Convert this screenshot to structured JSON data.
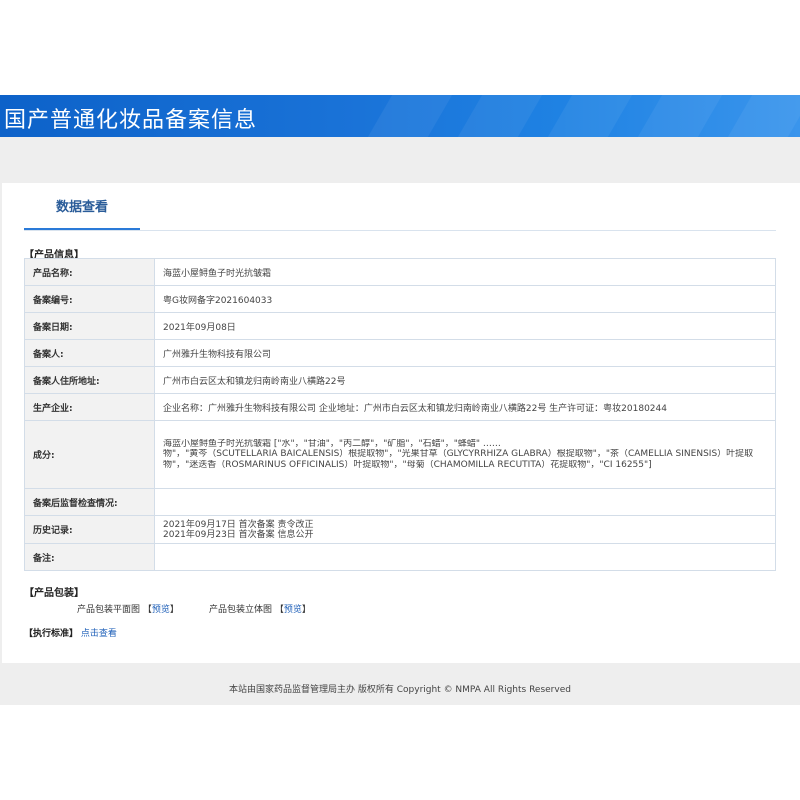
{
  "header": {
    "title": "国产普通化妆品备案信息"
  },
  "tabs": [
    {
      "label": "数据查看",
      "active": true
    }
  ],
  "product_info": {
    "section_label": "【产品信息】",
    "rows": [
      {
        "key": "产品名称:",
        "value": "海蓝小屋鲟鱼子时光抗皱霜"
      },
      {
        "key": "备案编号:",
        "value": "粤G妆网备字2021604033"
      },
      {
        "key": "备案日期:",
        "value": "2021年09月08日"
      },
      {
        "key": "备案人:",
        "value": "广州雅升生物科技有限公司"
      },
      {
        "key": "备案人住所地址:",
        "value": "广州市白云区太和镇龙归南岭南业八横路22号"
      },
      {
        "key": "生产企业:",
        "value": "企业名称：广州雅升生物科技有限公司 企业地址：广州市白云区太和镇龙归南岭南业八横路22号 生产许可证：粤妆20180244"
      },
      {
        "key": "成分:",
        "lines": [
          "海蓝小屋鲟鱼子时光抗皱霜 [\"水\"，\"甘油\"，\"丙二醇\"，\"矿脂\"，\"石蜡\"，\"蜂蜡\" ……",
          "物\"，\"黄芩（SCUTELLARIA BAICALENSIS）根提取物\"，\"光果甘草（GLYCYRRHIZA GLABRA）根提取物\"，\"茶（CAMELLIA SINENSIS）叶提取",
          "物\"，\"迷迭香（ROSMARINUS OFFICINALIS）叶提取物\"，\"母菊（CHAMOMILLA RECUTITA）花提取物\"，\"CI 16255\"]"
        ]
      },
      {
        "key": "备案后监督检查情况:",
        "value": ""
      },
      {
        "key": "历史记录:",
        "lines": [
          "2021年09月17日 首次备案 责令改正",
          "2021年09月23日 首次备案 信息公开"
        ]
      },
      {
        "key": "备注:",
        "value": ""
      }
    ]
  },
  "packaging": {
    "section_label": "【产品包装】",
    "flat_label": "产品包装平面图",
    "solid_label": "产品包装立体图",
    "preview": "预览",
    "open_bracket": "【",
    "close_bracket": "】"
  },
  "standard": {
    "section_label": "【执行标准】",
    "link": "点击查看"
  },
  "footer": {
    "text": "本站由国家药品监督管理局主办 版权所有 Copyright © NMPA All Rights Reserved"
  }
}
